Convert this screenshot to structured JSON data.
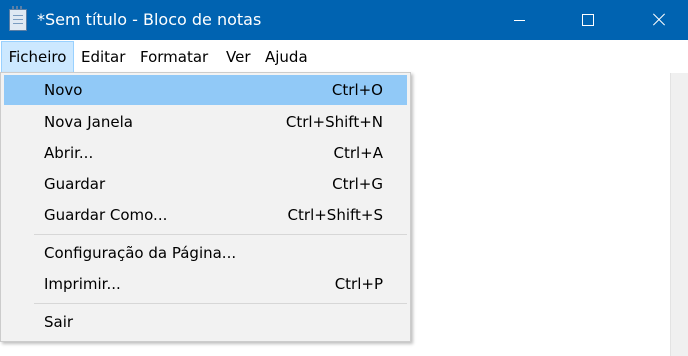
{
  "window": {
    "title": "*Sem título - Bloco de notas",
    "app_icon": "notepad-icon",
    "controls": [
      "minimize-icon",
      "maximize-icon",
      "close-icon"
    ],
    "title_bar_color": "#0063b1"
  },
  "menubar": {
    "items": [
      {
        "label": "Ficheiro",
        "active": true
      },
      {
        "label": "Editar",
        "active": false
      },
      {
        "label": "Formatar",
        "active": false
      },
      {
        "label": "Ver",
        "active": false
      },
      {
        "label": "Ajuda",
        "active": false
      }
    ]
  },
  "file_menu": {
    "highlighted_item": "Novo",
    "highlight_color": "#91c9f7",
    "items": [
      {
        "label": "Novo",
        "shortcut": "Ctrl+O"
      },
      {
        "label": "Nova Janela",
        "shortcut": "Ctrl+Shift+N"
      },
      {
        "label": "Abrir...",
        "shortcut": "Ctrl+A"
      },
      {
        "label": "Guardar",
        "shortcut": "Ctrl+G"
      },
      {
        "label": "Guardar Como...",
        "shortcut": "Ctrl+Shift+S"
      },
      {
        "label": "Configuração da Página...",
        "shortcut": ""
      },
      {
        "label": "Imprimir...",
        "shortcut": "Ctrl+P"
      },
      {
        "label": "Sair",
        "shortcut": ""
      }
    ]
  }
}
